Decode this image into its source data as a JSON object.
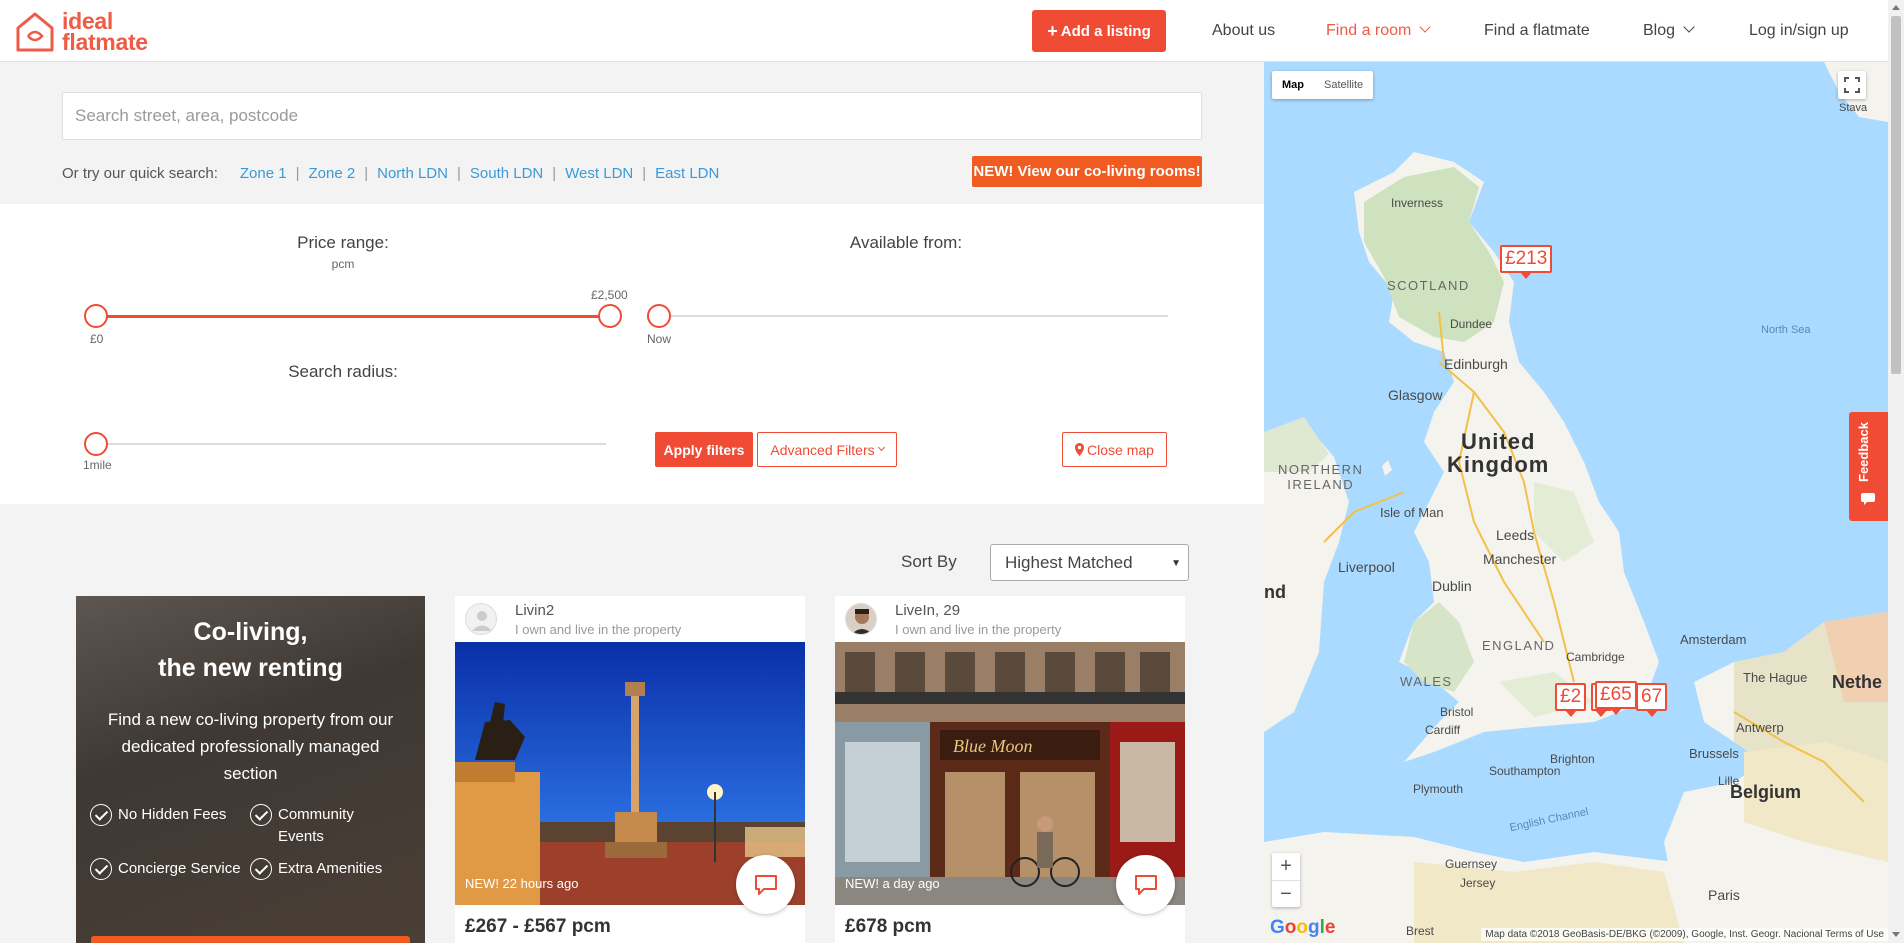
{
  "brand": {
    "line1": "ideal",
    "line2": "flatmate",
    "color": "#ef5b45"
  },
  "nav": {
    "add_listing": "Add a listing",
    "about": "About us",
    "find_room": "Find a room",
    "find_flatmate": "Find a flatmate",
    "blog": "Blog",
    "login": "Log in/sign up"
  },
  "search": {
    "placeholder": "Search street, area, postcode",
    "quick_label": "Or try our quick search:",
    "quick_links": [
      "Zone 1",
      "Zone 2",
      "North LDN",
      "South LDN",
      "West LDN",
      "East LDN"
    ],
    "coliving_button": "NEW! View our co-living rooms!"
  },
  "filters": {
    "price_label": "Price range:",
    "price_unit": "pcm",
    "price_min": "£0",
    "price_max": "£2,500",
    "available_label": "Available from:",
    "available_value": "Now",
    "radius_label": "Search radius:",
    "radius_value": "1mile",
    "apply": "Apply filters",
    "advanced": "Advanced Filters",
    "close_map": "Close map"
  },
  "sort": {
    "label": "Sort By",
    "selected": "Highest Matched"
  },
  "promo": {
    "title_line1": "Co-living,",
    "title_line2": "the new renting",
    "body": "Find a new co-living property from our dedicated professionally managed section",
    "features": [
      "No Hidden Fees",
      "Community Events",
      "Concierge Service",
      "Extra Amenities"
    ]
  },
  "listings": [
    {
      "name": "Livin2",
      "role": "I own and live in the property",
      "tag": "NEW! 22 hours ago",
      "price": "£267 - £567 pcm"
    },
    {
      "name": "LiveIn, 29",
      "role": "I own and live in the property",
      "tag": "NEW! a day ago",
      "price": "£678 pcm"
    }
  ],
  "map": {
    "type_map": "Map",
    "type_satellite": "Satellite",
    "markers": [
      "£213",
      "£2",
      "£",
      "£65",
      "67"
    ],
    "labels": {
      "uk": [
        "United",
        "Kingdom"
      ],
      "scotland": "SCOTLAND",
      "england": "ENGLAND",
      "wales": "WALES",
      "northern_ireland": [
        "NORTHERN",
        "IRELAND"
      ],
      "isle_of_man": "Isle of Man",
      "north_sea": "North Sea",
      "english_channel": "English Channel",
      "cities": [
        "Inverness",
        "Dundee",
        "Edinburgh",
        "Glasgow",
        "Leeds",
        "Manchester",
        "Liverpool",
        "Dublin",
        "Cambridge",
        "Bristol",
        "Cardiff",
        "Brighton",
        "Southampton",
        "Plymouth",
        "Amsterdam",
        "The Hague",
        "Antwerp",
        "Brussels",
        "Lille",
        "Paris",
        "Guernsey",
        "Jersey",
        "Brest",
        "Stava",
        "nd"
      ],
      "netherlands": "Nethe",
      "belgium": "Belgium"
    },
    "zoom_in": "+",
    "zoom_out": "−",
    "google": "Google",
    "attribution": "Map data ©2018 GeoBasis-DE/BKG (©2009), Google, Inst. Geogr. Nacional   Terms of Use"
  },
  "feedback": "Feedback"
}
